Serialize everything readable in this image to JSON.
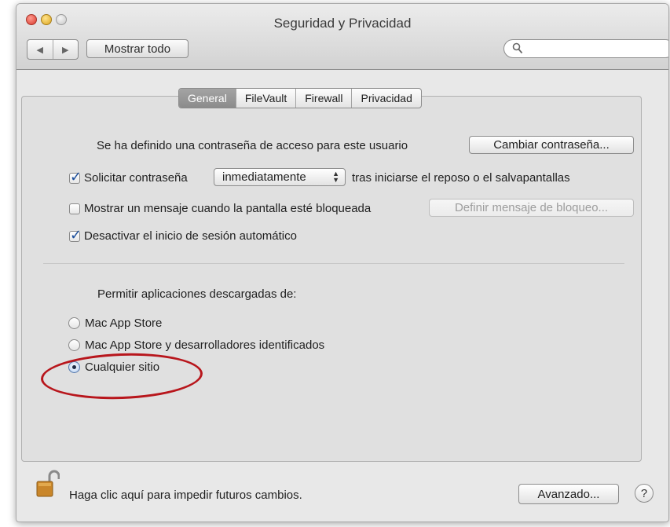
{
  "window": {
    "title": "Seguridad y Privacidad"
  },
  "toolbar": {
    "back_glyph": "◀",
    "forward_glyph": "▶",
    "show_all_label": "Mostrar todo",
    "search_placeholder": ""
  },
  "tabs": [
    {
      "label": "General",
      "active": true
    },
    {
      "label": "FileVault",
      "active": false
    },
    {
      "label": "Firewall",
      "active": false
    },
    {
      "label": "Privacidad",
      "active": false
    }
  ],
  "general": {
    "password_text": "Se ha definido una contraseña de acceso para este usuario",
    "change_password_button": "Cambiar contraseña...",
    "require_password": {
      "checked": true,
      "label": "Solicitar contraseña",
      "popup_value": "inmediatamente",
      "suffix": "tras iniciarse el reposo o el salvapantallas"
    },
    "show_message": {
      "checked": false,
      "label": "Mostrar un mensaje cuando la pantalla esté bloqueada",
      "button": "Definir mensaje de bloqueo..."
    },
    "disable_auto_login": {
      "checked": true,
      "label": "Desactivar el inicio de sesión automático"
    },
    "allow_apps_heading": "Permitir aplicaciones descargadas de:",
    "allow_options": [
      {
        "label": "Mac App Store",
        "selected": false
      },
      {
        "label": "Mac App Store y desarrolladores identificados",
        "selected": false
      },
      {
        "label": "Cualquier sitio",
        "selected": true
      }
    ]
  },
  "footer": {
    "lock_text": "Haga clic aquí para impedir futuros cambios.",
    "advanced_button": "Avanzado...",
    "help_glyph": "?"
  },
  "colors": {
    "annotation_circle": "#b8161c",
    "checkmark": "#1b4e9b"
  },
  "icons": {
    "search": "magnifier-icon",
    "lock": "unlocked-padlock-icon",
    "help": "question-mark-icon"
  }
}
